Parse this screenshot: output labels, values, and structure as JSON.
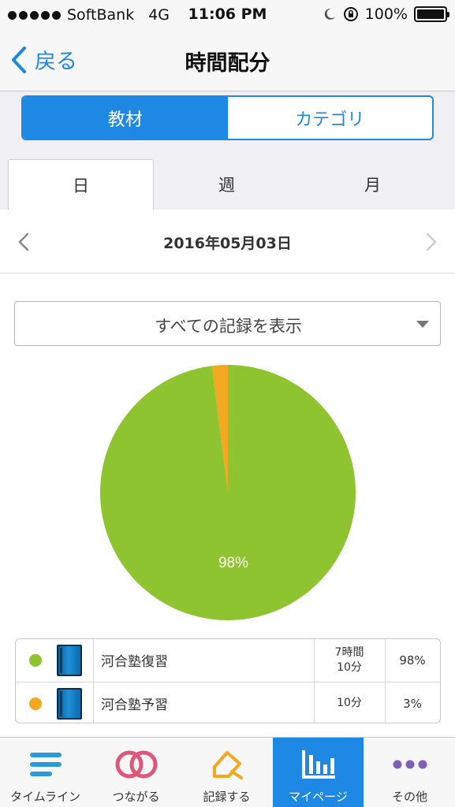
{
  "status": {
    "carrier": "SoftBank",
    "network": "4G",
    "time": "11:06 PM",
    "battery": "100%"
  },
  "nav": {
    "back_label": "戻る",
    "title": "時間配分"
  },
  "segmented": {
    "options": [
      "教材",
      "カテゴリ"
    ],
    "selected": 0
  },
  "period_tabs": {
    "options": [
      "日",
      "週",
      "月"
    ],
    "selected": 0
  },
  "date": "2016年05月03日",
  "filter": {
    "selected": "すべての記録を表示"
  },
  "chart_data": {
    "type": "pie",
    "slices": [
      {
        "label": "河合塾復習",
        "value": 98,
        "color": "#8dc42f"
      },
      {
        "label": "河合塾予習",
        "value": 2,
        "color": "#f2a91f"
      }
    ],
    "data_labels": [
      "98%"
    ]
  },
  "legend": [
    {
      "color": "#8dc42f",
      "name": "河合塾復習",
      "time_line1": "7時間",
      "time_line2": "10分",
      "percent": "98%"
    },
    {
      "color": "#f2a91f",
      "name": "河合塾予習",
      "time_line1": "10分",
      "time_line2": "",
      "percent": "3%"
    }
  ],
  "tabbar": {
    "items": [
      {
        "label": "タイムライン",
        "icon": "timeline-icon"
      },
      {
        "label": "つながる",
        "icon": "connect-rings-icon"
      },
      {
        "label": "記録する",
        "icon": "pencil-record-icon"
      },
      {
        "label": "マイページ",
        "icon": "bar-chart-icon"
      },
      {
        "label": "その他",
        "icon": "more-dots-icon"
      }
    ],
    "selected": 3
  },
  "colors": {
    "accent": "#1e88e5",
    "green": "#8dc42f",
    "orange": "#f2a91f"
  }
}
